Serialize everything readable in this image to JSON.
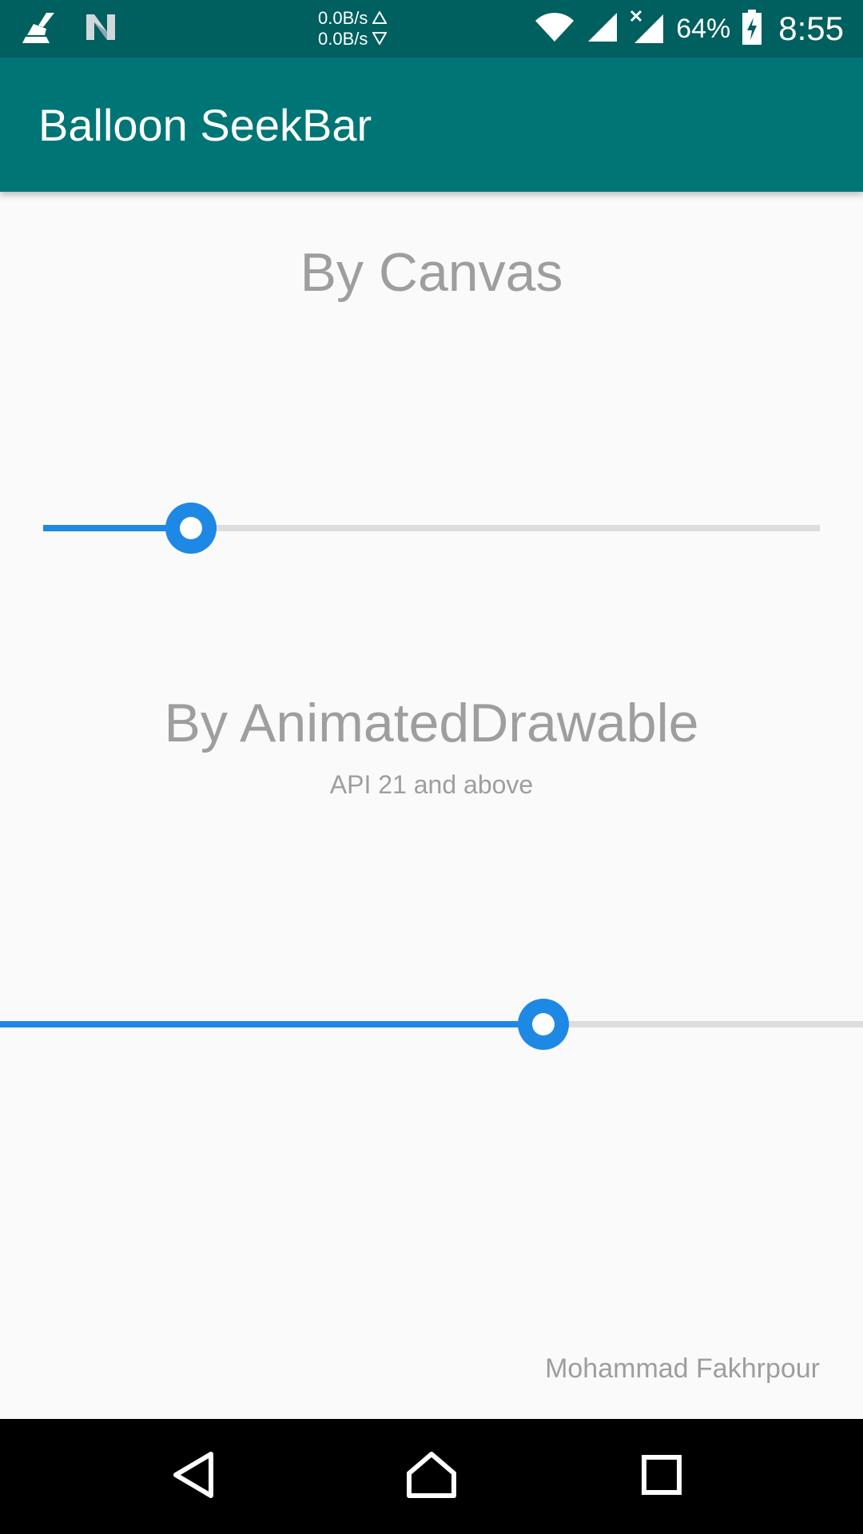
{
  "status_bar": {
    "net_up": "0.0B/s",
    "net_down": "0.0B/s",
    "battery_percent": "64%",
    "time": "8:55",
    "icons": [
      "broom-icon",
      "n-logo-icon",
      "wifi-icon",
      "signal-icon",
      "signal-x-icon",
      "battery-charging-icon"
    ]
  },
  "app_bar": {
    "title": "Balloon SeekBar"
  },
  "sections": [
    {
      "title": "By Canvas",
      "subtitle": "",
      "progress": 0.19
    },
    {
      "title": "By AnimatedDrawable",
      "subtitle": "API 21 and above",
      "progress": 0.63
    }
  ],
  "footer": {
    "author": "Mohammad Fakhrpour"
  },
  "nav_bar": {
    "icons": [
      "back-icon",
      "home-icon",
      "recents-icon"
    ]
  },
  "colors": {
    "status_bar": "#005f5f",
    "app_bar": "#007575",
    "accent": "#1e88e5",
    "track": "#dddddd",
    "text_gray": "#9e9e9e"
  }
}
